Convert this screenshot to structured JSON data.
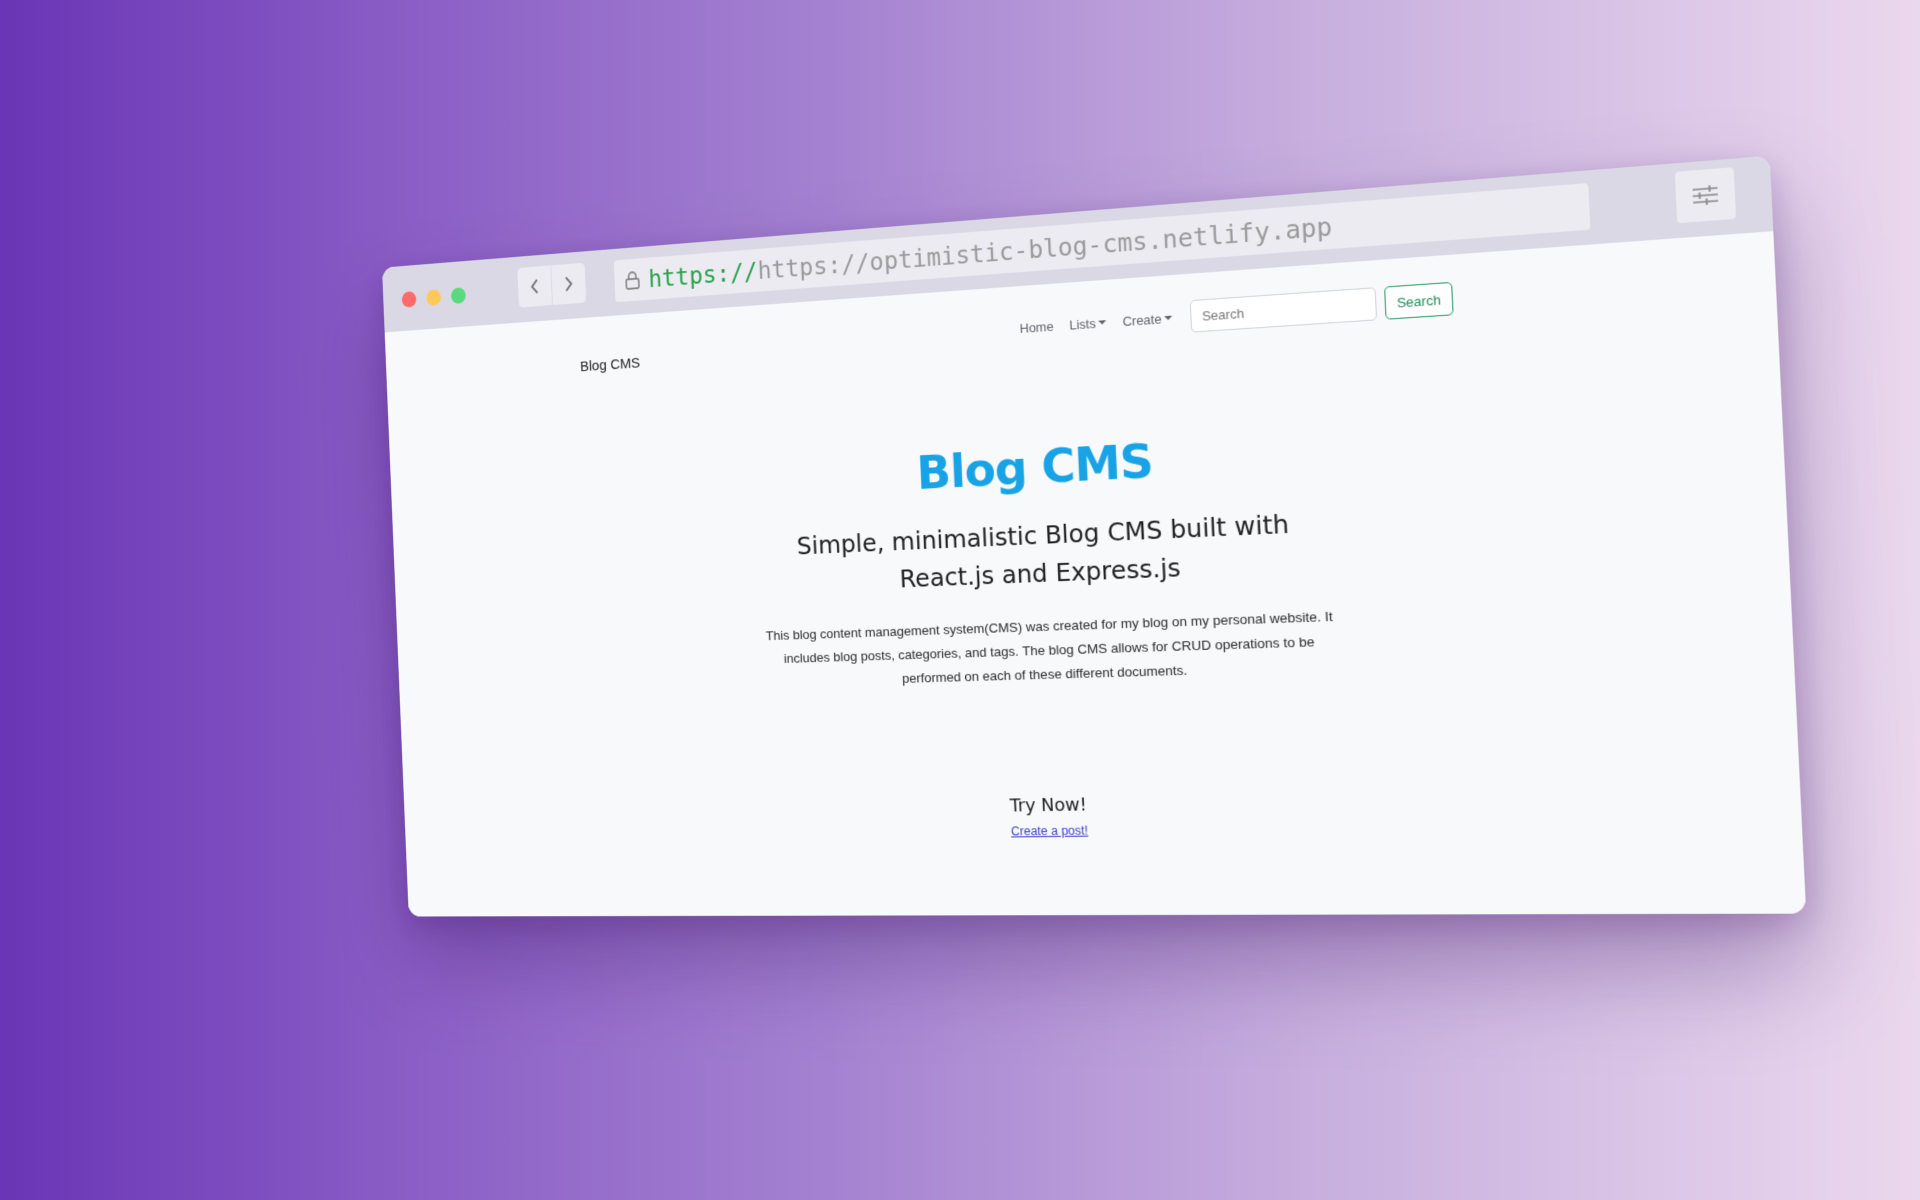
{
  "browser": {
    "url_scheme": "https://",
    "url_rest": "https://optimistic-blog-cms.netlify.app",
    "icons": {
      "back": "chevron-left-icon",
      "forward": "chevron-right-icon",
      "lock": "lock-icon",
      "settings": "sliders-icon"
    },
    "traffic_lights": {
      "close": "#ff6b6b",
      "minimize": "#ffc95a",
      "maximize": "#59d97c"
    }
  },
  "navbar": {
    "brand": "Blog CMS",
    "links": {
      "home": "Home",
      "lists": "Lists",
      "create": "Create"
    },
    "search": {
      "placeholder": "Search",
      "value": "",
      "button_label": "Search"
    }
  },
  "hero": {
    "title": "Blog CMS",
    "subtitle": "Simple, minimalistic Blog CMS built with React.js and Express.js",
    "description": "This blog content management system(CMS) was created for my blog on my personal website. It includes blog posts, categories, and tags. The blog CMS allows for CRUD operations to be performed on each of these different documents."
  },
  "cta": {
    "title": "Try Now!",
    "link_label": "Create a post!"
  },
  "colors": {
    "accent": "#18a3e6",
    "search_button": "#2f9a66",
    "link": "#3a3fd0",
    "url_scheme": "#26a24a"
  }
}
